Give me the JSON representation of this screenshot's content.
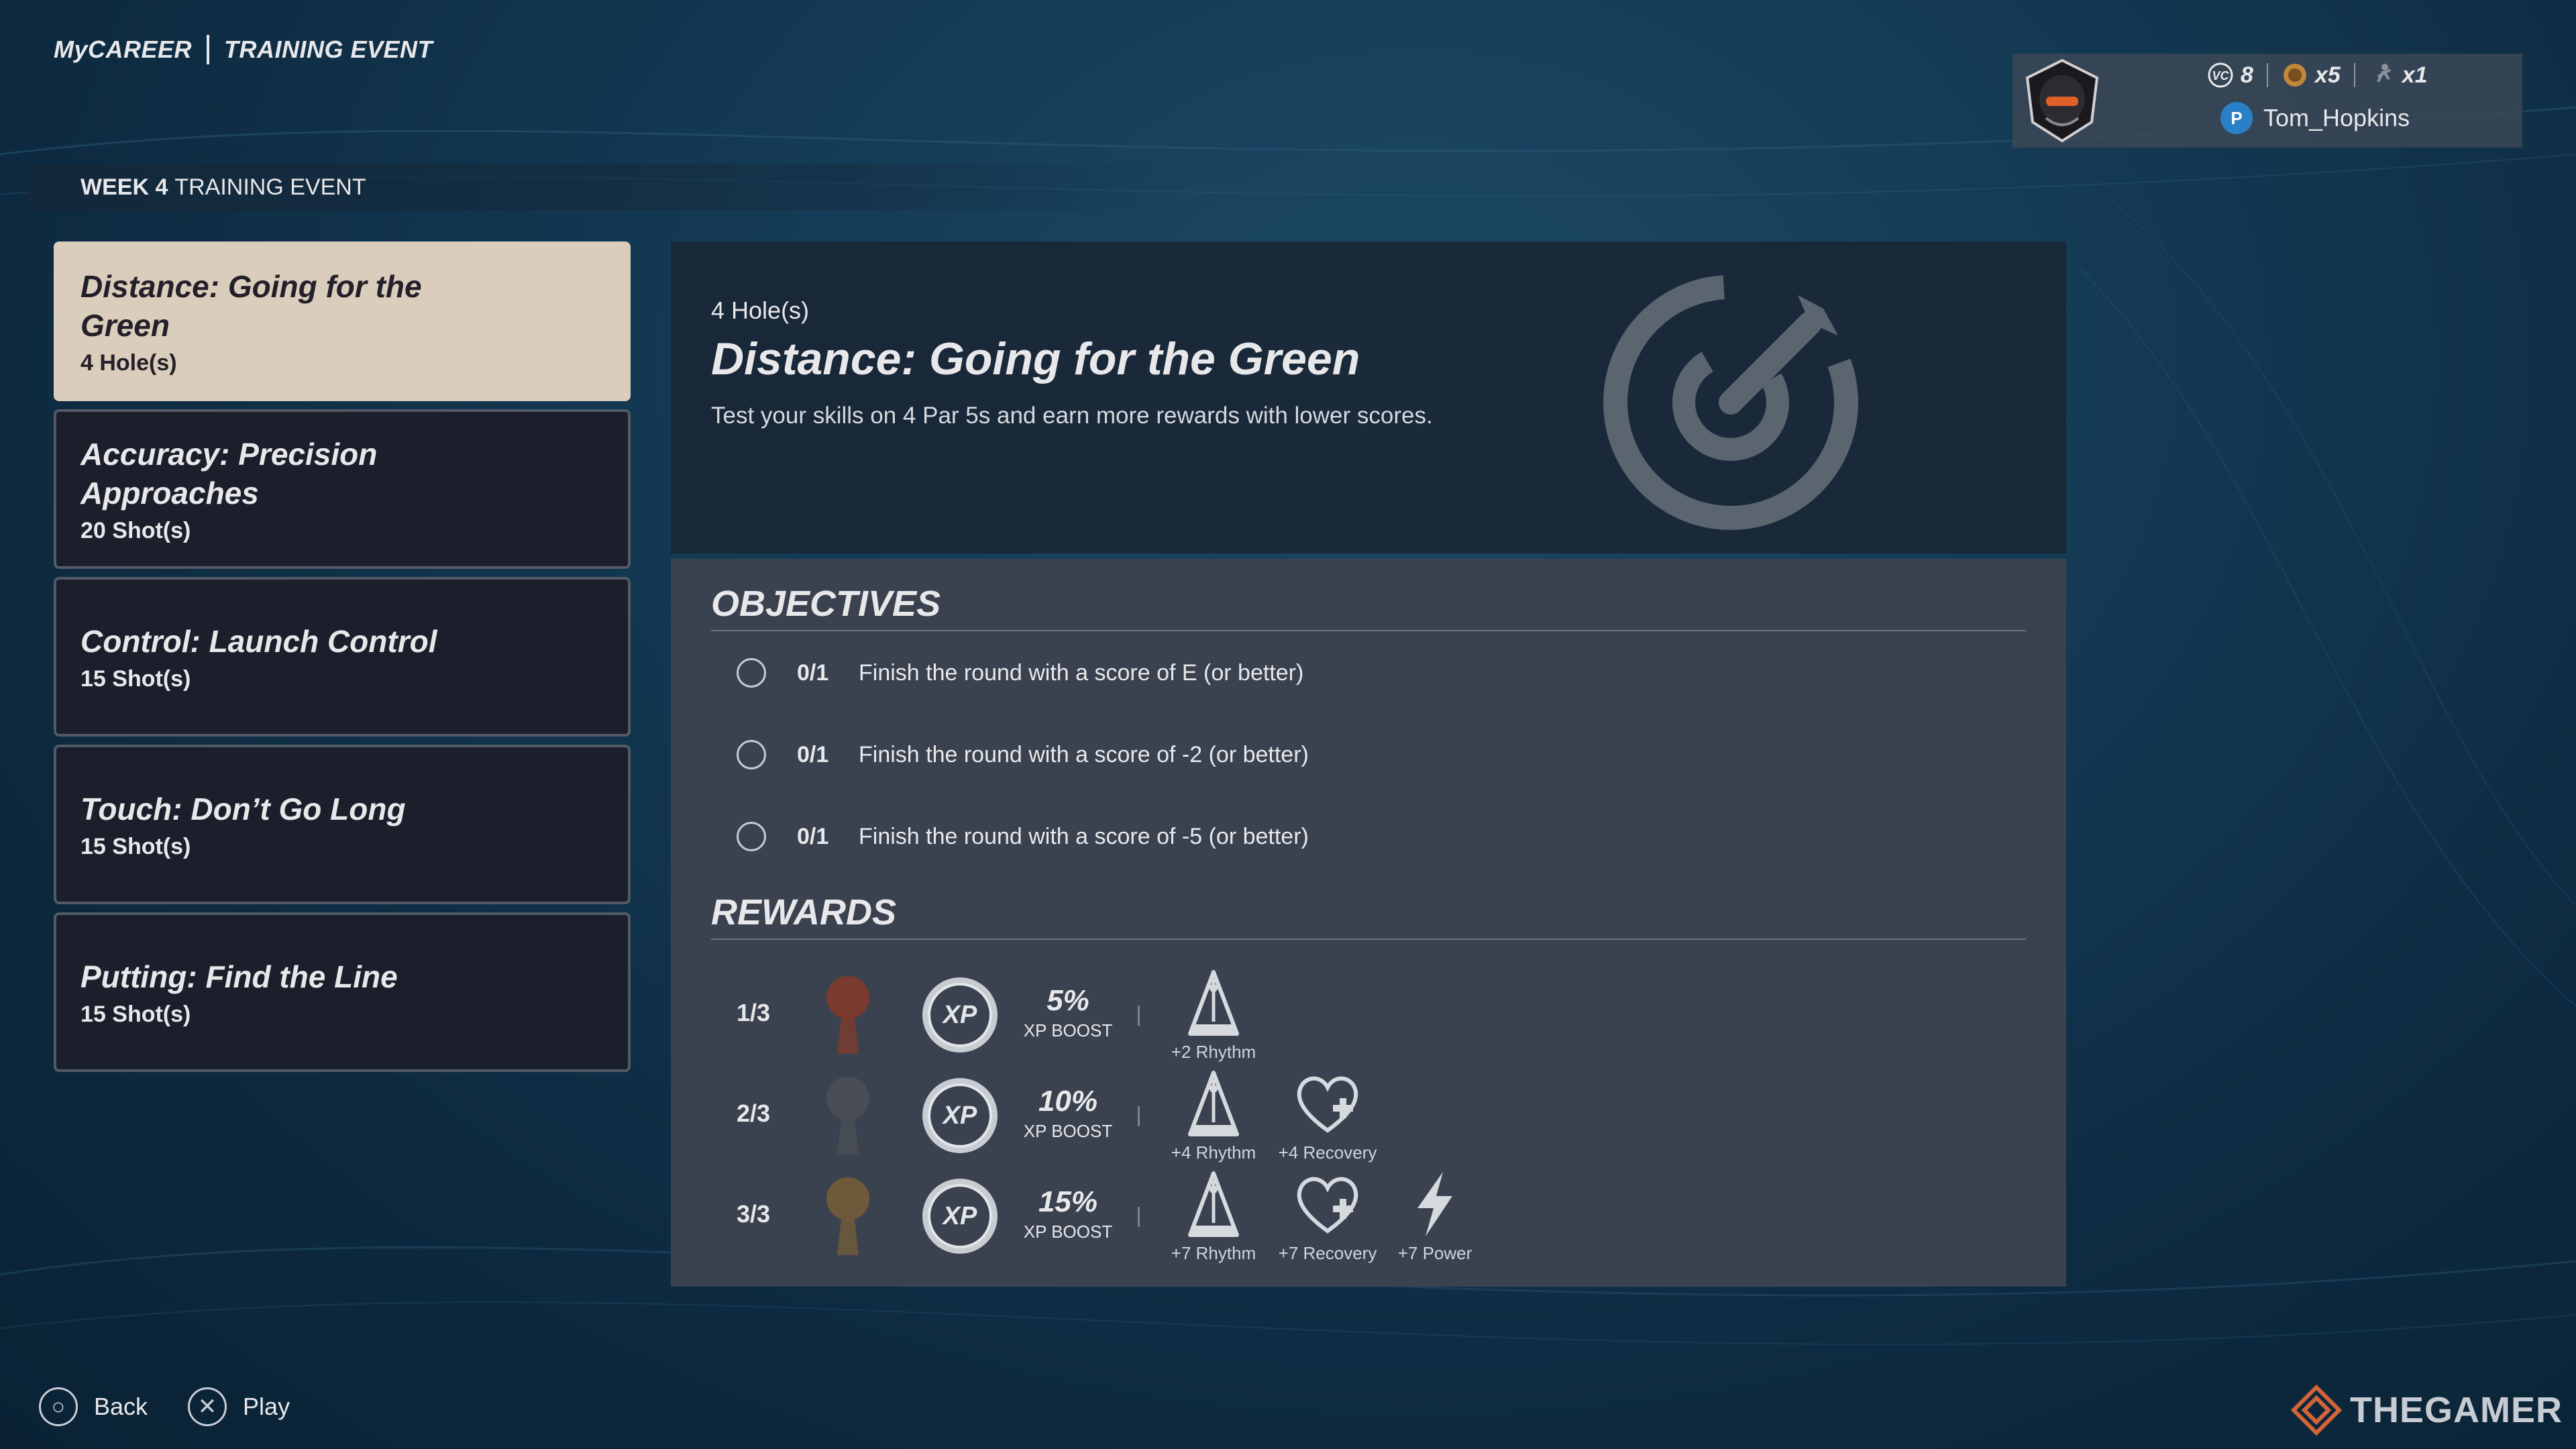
{
  "header": {
    "section": "MyCAREER",
    "subsection": "TRAINING EVENT"
  },
  "profile": {
    "vc_amount": "8",
    "currency2_amount": "x5",
    "currency3_amount": "x1",
    "username": "Tom_Hopkins"
  },
  "week_bar": {
    "week": "WEEK 4",
    "label": "TRAINING EVENT"
  },
  "events": [
    {
      "title": "Distance: Going for the Green",
      "sub": "4 Hole(s)"
    },
    {
      "title": "Accuracy: Precision Approaches",
      "sub": "20 Shot(s)"
    },
    {
      "title": "Control: Launch Control",
      "sub": "15 Shot(s)"
    },
    {
      "title": "Touch: Don’t Go Long",
      "sub": "15 Shot(s)"
    },
    {
      "title": "Putting: Find the Line",
      "sub": "15 Shot(s)"
    }
  ],
  "detail": {
    "count": "4 Hole(s)",
    "title": "Distance: Going for the Green",
    "description": "Test your skills on 4 Par 5s and earn more rewards with lower scores."
  },
  "objectives": {
    "heading": "OBJECTIVES",
    "items": [
      {
        "progress": "0/1",
        "text": "Finish the round with a score of E (or better)"
      },
      {
        "progress": "0/1",
        "text": "Finish the round with a score of -2 (or better)"
      },
      {
        "progress": "0/1",
        "text": "Finish the round with a score of -5 (or better)"
      }
    ]
  },
  "rewards": {
    "heading": "REWARDS",
    "xp_label": "XP",
    "boost_label": "XP BOOST",
    "tiers": [
      {
        "tier": "1/3",
        "boost": "5%",
        "attrs": [
          "+2 Rhythm"
        ],
        "trophy_color": "#7a3b2e"
      },
      {
        "tier": "2/3",
        "boost": "10%",
        "attrs": [
          "+4 Rhythm",
          "+4 Recovery"
        ],
        "trophy_color": "#4a4d55"
      },
      {
        "tier": "3/3",
        "boost": "15%",
        "attrs": [
          "+7 Rhythm",
          "+7 Recovery",
          "+7 Power"
        ],
        "trophy_color": "#6e5a3a"
      }
    ]
  },
  "footer": {
    "back_label": "Back",
    "play_label": "Play"
  },
  "watermark": "THEGAMER"
}
